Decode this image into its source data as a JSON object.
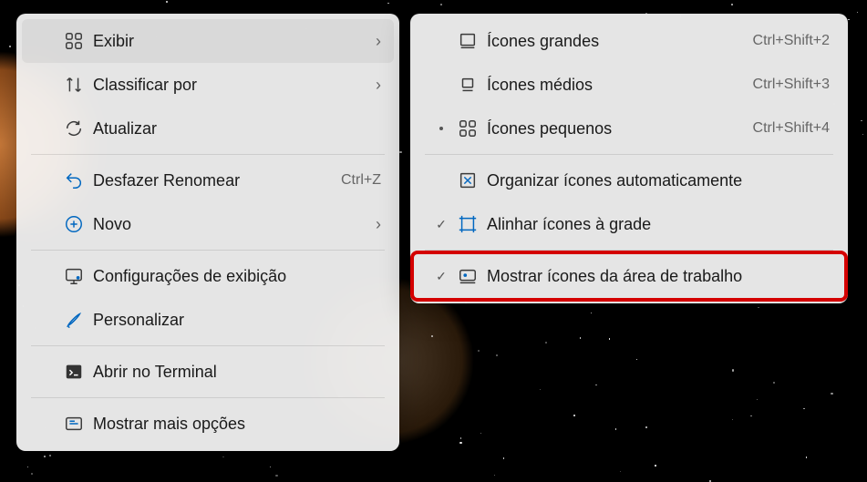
{
  "mainMenu": [
    {
      "label": "Exibir",
      "hasSub": true,
      "hover": true,
      "icon": "grid"
    },
    {
      "label": "Classificar por",
      "hasSub": true,
      "icon": "sort"
    },
    {
      "label": "Atualizar",
      "icon": "refresh"
    },
    {
      "sep": true
    },
    {
      "label": "Desfazer Renomear",
      "accel": "Ctrl+Z",
      "icon": "undo"
    },
    {
      "label": "Novo",
      "hasSub": true,
      "icon": "plus"
    },
    {
      "sep": true
    },
    {
      "label": "Configurações de exibição",
      "icon": "display"
    },
    {
      "label": "Personalizar",
      "icon": "brush"
    },
    {
      "sep": true
    },
    {
      "label": "Abrir no Terminal",
      "icon": "terminal"
    },
    {
      "sep": true
    },
    {
      "label": "Mostrar mais opções",
      "icon": "more"
    }
  ],
  "subMenu": [
    {
      "label": "Ícones grandes",
      "accel": "Ctrl+Shift+2",
      "icon": "large"
    },
    {
      "label": "Ícones médios",
      "accel": "Ctrl+Shift+3",
      "icon": "medium"
    },
    {
      "label": "Ícones pequenos",
      "accel": "Ctrl+Shift+4",
      "icon": "small",
      "bullet": true
    },
    {
      "sep": true
    },
    {
      "label": "Organizar ícones automaticamente",
      "icon": "auto"
    },
    {
      "label": "Alinhar ícones à grade",
      "icon": "align",
      "checked": true
    },
    {
      "sep": true
    },
    {
      "label": "Mostrar ícones da área de trabalho",
      "icon": "desktop",
      "checked": true,
      "highlight": true
    }
  ],
  "chevron": "›",
  "checkmark": "✓"
}
